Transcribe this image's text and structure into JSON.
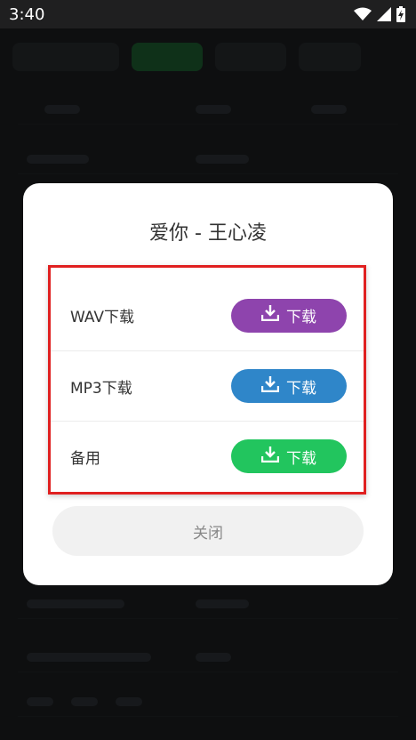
{
  "status_bar": {
    "time": "3:40",
    "icons": [
      "wifi-icon",
      "signal-icon",
      "battery-charging-icon"
    ]
  },
  "dialog": {
    "title": "爱你 - 王心凌",
    "options": [
      {
        "label": "WAV下载",
        "button_label": "下载",
        "button_color": "#8e44ad"
      },
      {
        "label": "MP3下载",
        "button_label": "下载",
        "button_color": "#2f86c9"
      },
      {
        "label": "备用",
        "button_label": "下载",
        "button_color": "#22c55e"
      }
    ],
    "close_label": "关闭"
  }
}
